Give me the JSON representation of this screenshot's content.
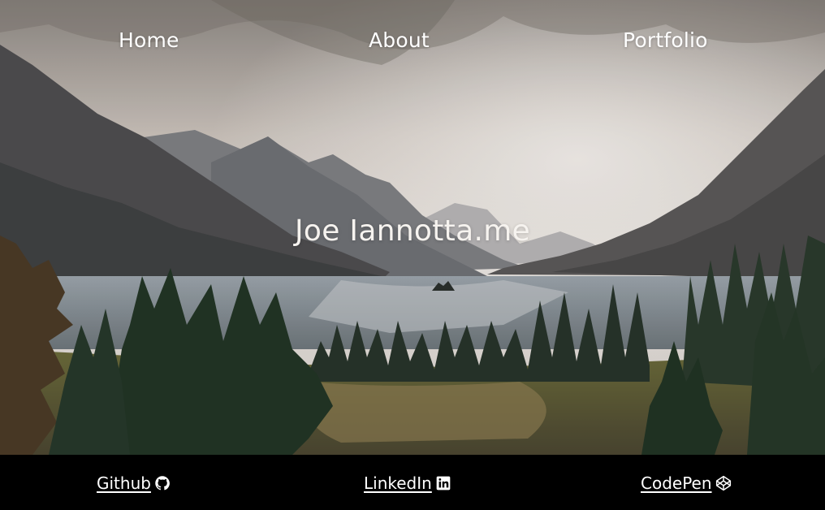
{
  "nav": {
    "items": [
      {
        "label": "Home"
      },
      {
        "label": "About"
      },
      {
        "label": "Portfolio"
      }
    ]
  },
  "hero": {
    "title": "Joe Iannotta.me",
    "background": "mountain-lake-landscape"
  },
  "footer": {
    "links": [
      {
        "label": "Github",
        "icon": "github-icon"
      },
      {
        "label": "LinkedIn",
        "icon": "linkedin-icon"
      },
      {
        "label": "CodePen",
        "icon": "codepen-icon"
      }
    ]
  },
  "colors": {
    "footer_bg": "#000000",
    "text": "#ffffff"
  }
}
